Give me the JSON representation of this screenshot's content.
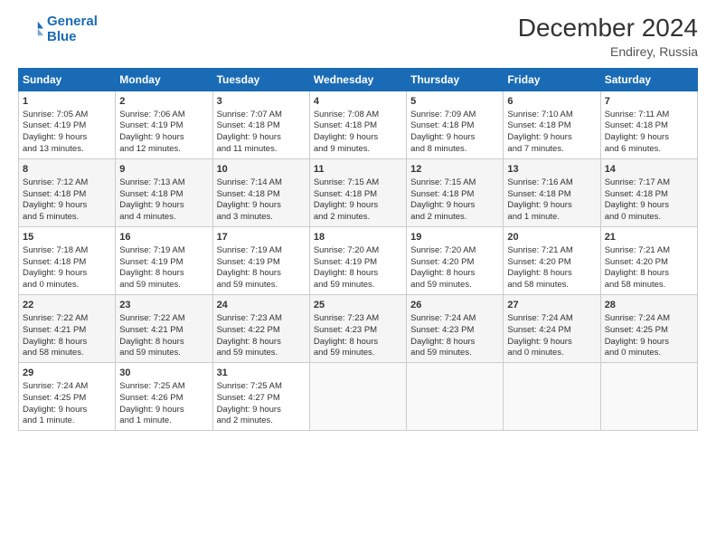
{
  "header": {
    "logo_line1": "General",
    "logo_line2": "Blue",
    "title": "December 2024",
    "subtitle": "Endirey, Russia"
  },
  "days_header": [
    "Sunday",
    "Monday",
    "Tuesday",
    "Wednesday",
    "Thursday",
    "Friday",
    "Saturday"
  ],
  "weeks": [
    [
      {
        "day": "1",
        "lines": [
          "Sunrise: 7:05 AM",
          "Sunset: 4:19 PM",
          "Daylight: 9 hours",
          "and 13 minutes."
        ]
      },
      {
        "day": "2",
        "lines": [
          "Sunrise: 7:06 AM",
          "Sunset: 4:19 PM",
          "Daylight: 9 hours",
          "and 12 minutes."
        ]
      },
      {
        "day": "3",
        "lines": [
          "Sunrise: 7:07 AM",
          "Sunset: 4:18 PM",
          "Daylight: 9 hours",
          "and 11 minutes."
        ]
      },
      {
        "day": "4",
        "lines": [
          "Sunrise: 7:08 AM",
          "Sunset: 4:18 PM",
          "Daylight: 9 hours",
          "and 9 minutes."
        ]
      },
      {
        "day": "5",
        "lines": [
          "Sunrise: 7:09 AM",
          "Sunset: 4:18 PM",
          "Daylight: 9 hours",
          "and 8 minutes."
        ]
      },
      {
        "day": "6",
        "lines": [
          "Sunrise: 7:10 AM",
          "Sunset: 4:18 PM",
          "Daylight: 9 hours",
          "and 7 minutes."
        ]
      },
      {
        "day": "7",
        "lines": [
          "Sunrise: 7:11 AM",
          "Sunset: 4:18 PM",
          "Daylight: 9 hours",
          "and 6 minutes."
        ]
      }
    ],
    [
      {
        "day": "8",
        "lines": [
          "Sunrise: 7:12 AM",
          "Sunset: 4:18 PM",
          "Daylight: 9 hours",
          "and 5 minutes."
        ]
      },
      {
        "day": "9",
        "lines": [
          "Sunrise: 7:13 AM",
          "Sunset: 4:18 PM",
          "Daylight: 9 hours",
          "and 4 minutes."
        ]
      },
      {
        "day": "10",
        "lines": [
          "Sunrise: 7:14 AM",
          "Sunset: 4:18 PM",
          "Daylight: 9 hours",
          "and 3 minutes."
        ]
      },
      {
        "day": "11",
        "lines": [
          "Sunrise: 7:15 AM",
          "Sunset: 4:18 PM",
          "Daylight: 9 hours",
          "and 2 minutes."
        ]
      },
      {
        "day": "12",
        "lines": [
          "Sunrise: 7:15 AM",
          "Sunset: 4:18 PM",
          "Daylight: 9 hours",
          "and 2 minutes."
        ]
      },
      {
        "day": "13",
        "lines": [
          "Sunrise: 7:16 AM",
          "Sunset: 4:18 PM",
          "Daylight: 9 hours",
          "and 1 minute."
        ]
      },
      {
        "day": "14",
        "lines": [
          "Sunrise: 7:17 AM",
          "Sunset: 4:18 PM",
          "Daylight: 9 hours",
          "and 0 minutes."
        ]
      }
    ],
    [
      {
        "day": "15",
        "lines": [
          "Sunrise: 7:18 AM",
          "Sunset: 4:18 PM",
          "Daylight: 9 hours",
          "and 0 minutes."
        ]
      },
      {
        "day": "16",
        "lines": [
          "Sunrise: 7:19 AM",
          "Sunset: 4:19 PM",
          "Daylight: 8 hours",
          "and 59 minutes."
        ]
      },
      {
        "day": "17",
        "lines": [
          "Sunrise: 7:19 AM",
          "Sunset: 4:19 PM",
          "Daylight: 8 hours",
          "and 59 minutes."
        ]
      },
      {
        "day": "18",
        "lines": [
          "Sunrise: 7:20 AM",
          "Sunset: 4:19 PM",
          "Daylight: 8 hours",
          "and 59 minutes."
        ]
      },
      {
        "day": "19",
        "lines": [
          "Sunrise: 7:20 AM",
          "Sunset: 4:20 PM",
          "Daylight: 8 hours",
          "and 59 minutes."
        ]
      },
      {
        "day": "20",
        "lines": [
          "Sunrise: 7:21 AM",
          "Sunset: 4:20 PM",
          "Daylight: 8 hours",
          "and 58 minutes."
        ]
      },
      {
        "day": "21",
        "lines": [
          "Sunrise: 7:21 AM",
          "Sunset: 4:20 PM",
          "Daylight: 8 hours",
          "and 58 minutes."
        ]
      }
    ],
    [
      {
        "day": "22",
        "lines": [
          "Sunrise: 7:22 AM",
          "Sunset: 4:21 PM",
          "Daylight: 8 hours",
          "and 58 minutes."
        ]
      },
      {
        "day": "23",
        "lines": [
          "Sunrise: 7:22 AM",
          "Sunset: 4:21 PM",
          "Daylight: 8 hours",
          "and 59 minutes."
        ]
      },
      {
        "day": "24",
        "lines": [
          "Sunrise: 7:23 AM",
          "Sunset: 4:22 PM",
          "Daylight: 8 hours",
          "and 59 minutes."
        ]
      },
      {
        "day": "25",
        "lines": [
          "Sunrise: 7:23 AM",
          "Sunset: 4:23 PM",
          "Daylight: 8 hours",
          "and 59 minutes."
        ]
      },
      {
        "day": "26",
        "lines": [
          "Sunrise: 7:24 AM",
          "Sunset: 4:23 PM",
          "Daylight: 8 hours",
          "and 59 minutes."
        ]
      },
      {
        "day": "27",
        "lines": [
          "Sunrise: 7:24 AM",
          "Sunset: 4:24 PM",
          "Daylight: 9 hours",
          "and 0 minutes."
        ]
      },
      {
        "day": "28",
        "lines": [
          "Sunrise: 7:24 AM",
          "Sunset: 4:25 PM",
          "Daylight: 9 hours",
          "and 0 minutes."
        ]
      }
    ],
    [
      {
        "day": "29",
        "lines": [
          "Sunrise: 7:24 AM",
          "Sunset: 4:25 PM",
          "Daylight: 9 hours",
          "and 1 minute."
        ]
      },
      {
        "day": "30",
        "lines": [
          "Sunrise: 7:25 AM",
          "Sunset: 4:26 PM",
          "Daylight: 9 hours",
          "and 1 minute."
        ]
      },
      {
        "day": "31",
        "lines": [
          "Sunrise: 7:25 AM",
          "Sunset: 4:27 PM",
          "Daylight: 9 hours",
          "and 2 minutes."
        ]
      },
      null,
      null,
      null,
      null
    ]
  ]
}
